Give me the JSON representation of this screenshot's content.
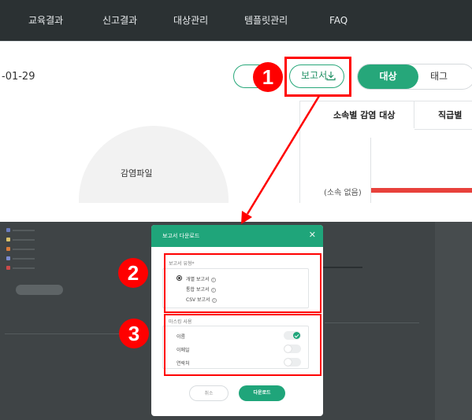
{
  "nav": {
    "items": [
      "교육결과",
      "신고결과",
      "대상관리",
      "템플릿관리",
      "FAQ"
    ]
  },
  "page": {
    "date_fragment": "-01-29",
    "report_button": "보고서",
    "segment": {
      "active": "대상",
      "inactive": "태그"
    },
    "donut_label": "감염파일",
    "tabs": [
      "소속별 감염 대상",
      "직급별"
    ],
    "axis_category": "(소속 없음)"
  },
  "callouts": {
    "one": "1",
    "two": "2",
    "three": "3"
  },
  "modal": {
    "title": "보고서 다운로드",
    "close": "✕",
    "report_type_label": "보고서 유형*",
    "report_types": [
      {
        "label": "개별 보고서",
        "checked": true
      },
      {
        "label": "통합 보고서",
        "checked": false
      },
      {
        "label": "CSV 보고서",
        "checked": false
      }
    ],
    "masking_label": "마스킹 사용",
    "masking_options": [
      {
        "label": "이름",
        "on": true
      },
      {
        "label": "이메일",
        "on": false
      },
      {
        "label": "연락처",
        "on": false
      }
    ],
    "cancel": "취소",
    "download": "다운로드"
  },
  "colors": {
    "accent": "#26a77a",
    "nav_bg": "#2b3133",
    "callout": "#ff0000"
  }
}
